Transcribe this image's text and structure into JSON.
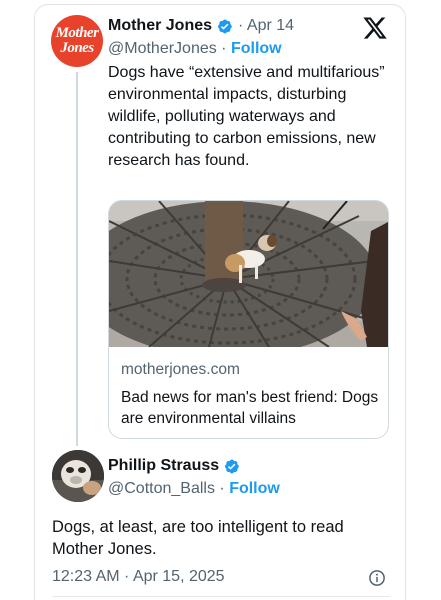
{
  "tweet": {
    "avatar_text_top": "Mother",
    "avatar_text_bottom": "Jones",
    "author_name": "Mother Jones",
    "date": "· Apr 14",
    "handle": "@MotherJones ·",
    "follow_label": "Follow",
    "text": "Dogs have “extensive and multifarious” environmental impacts, disturbing wildlife, polluting waterways and contributing to carbon emissions, new research has found.",
    "link_card": {
      "domain": "motherjones.com",
      "title": "Bad news for man's best friend: Dogs are environmental villains"
    }
  },
  "reply": {
    "author_name": "Phillip Strauss",
    "handle": "@Cotton_Balls ·",
    "follow_label": "Follow",
    "text": "Dogs, at least, are too intelligent to read Mother Jones.",
    "timestamp": "12:23 AM · Apr 15, 2025"
  },
  "colors": {
    "accent": "#1d9bf0",
    "brand_red": "#e8422a",
    "muted": "#536471"
  },
  "icons": [
    "x-logo-icon",
    "verified-badge-icon",
    "info-icon"
  ]
}
